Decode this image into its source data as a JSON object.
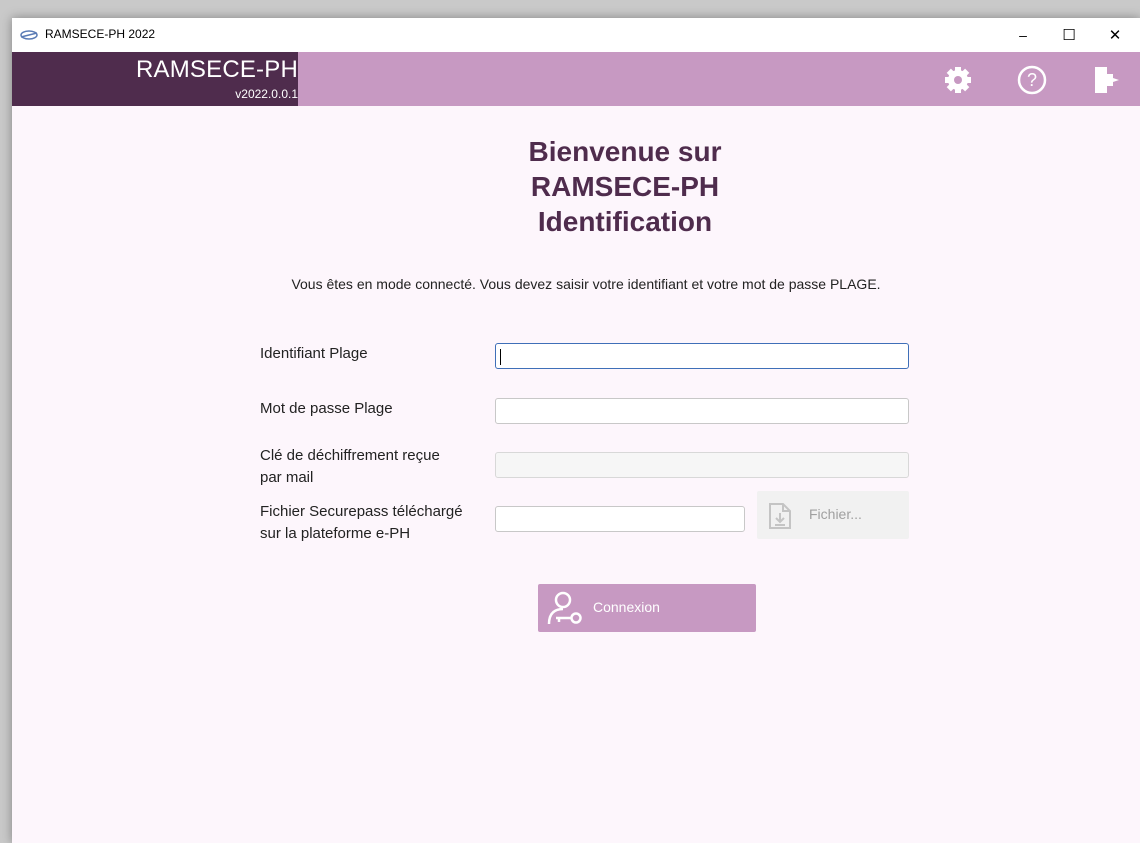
{
  "window": {
    "title": "RAMSECE-PH 2022",
    "minimize_symbol": "–",
    "maximize_symbol": "☐",
    "close_symbol": "✕"
  },
  "header": {
    "app_name": "RAMSECE-PH",
    "version": "v2022.0.0.1",
    "icons": [
      "gear-icon",
      "help-icon",
      "logout-icon"
    ],
    "colors": {
      "bar": "#c799c2",
      "brand": "#4f2c4d"
    }
  },
  "main": {
    "heading_line1": "Bienvenue sur",
    "heading_line2": "RAMSECE-PH",
    "heading_line3": "Identification",
    "intro": "Vous êtes en mode connecté. Vous devez saisir votre identifiant et votre mot de passe PLAGE."
  },
  "form": {
    "identifiant": {
      "label": "Identifiant Plage",
      "value": ""
    },
    "password": {
      "label": "Mot de passe Plage",
      "value": ""
    },
    "cle": {
      "label_line1": "Clé de déchiffrement reçue",
      "label_line2": "par mail",
      "value": ""
    },
    "fichier": {
      "label_line1": "Fichier Securepass téléchargé",
      "label_line2": "sur la plateforme e-PH",
      "value": "",
      "button_label": "Fichier..."
    },
    "connect_label": "Connexion"
  }
}
